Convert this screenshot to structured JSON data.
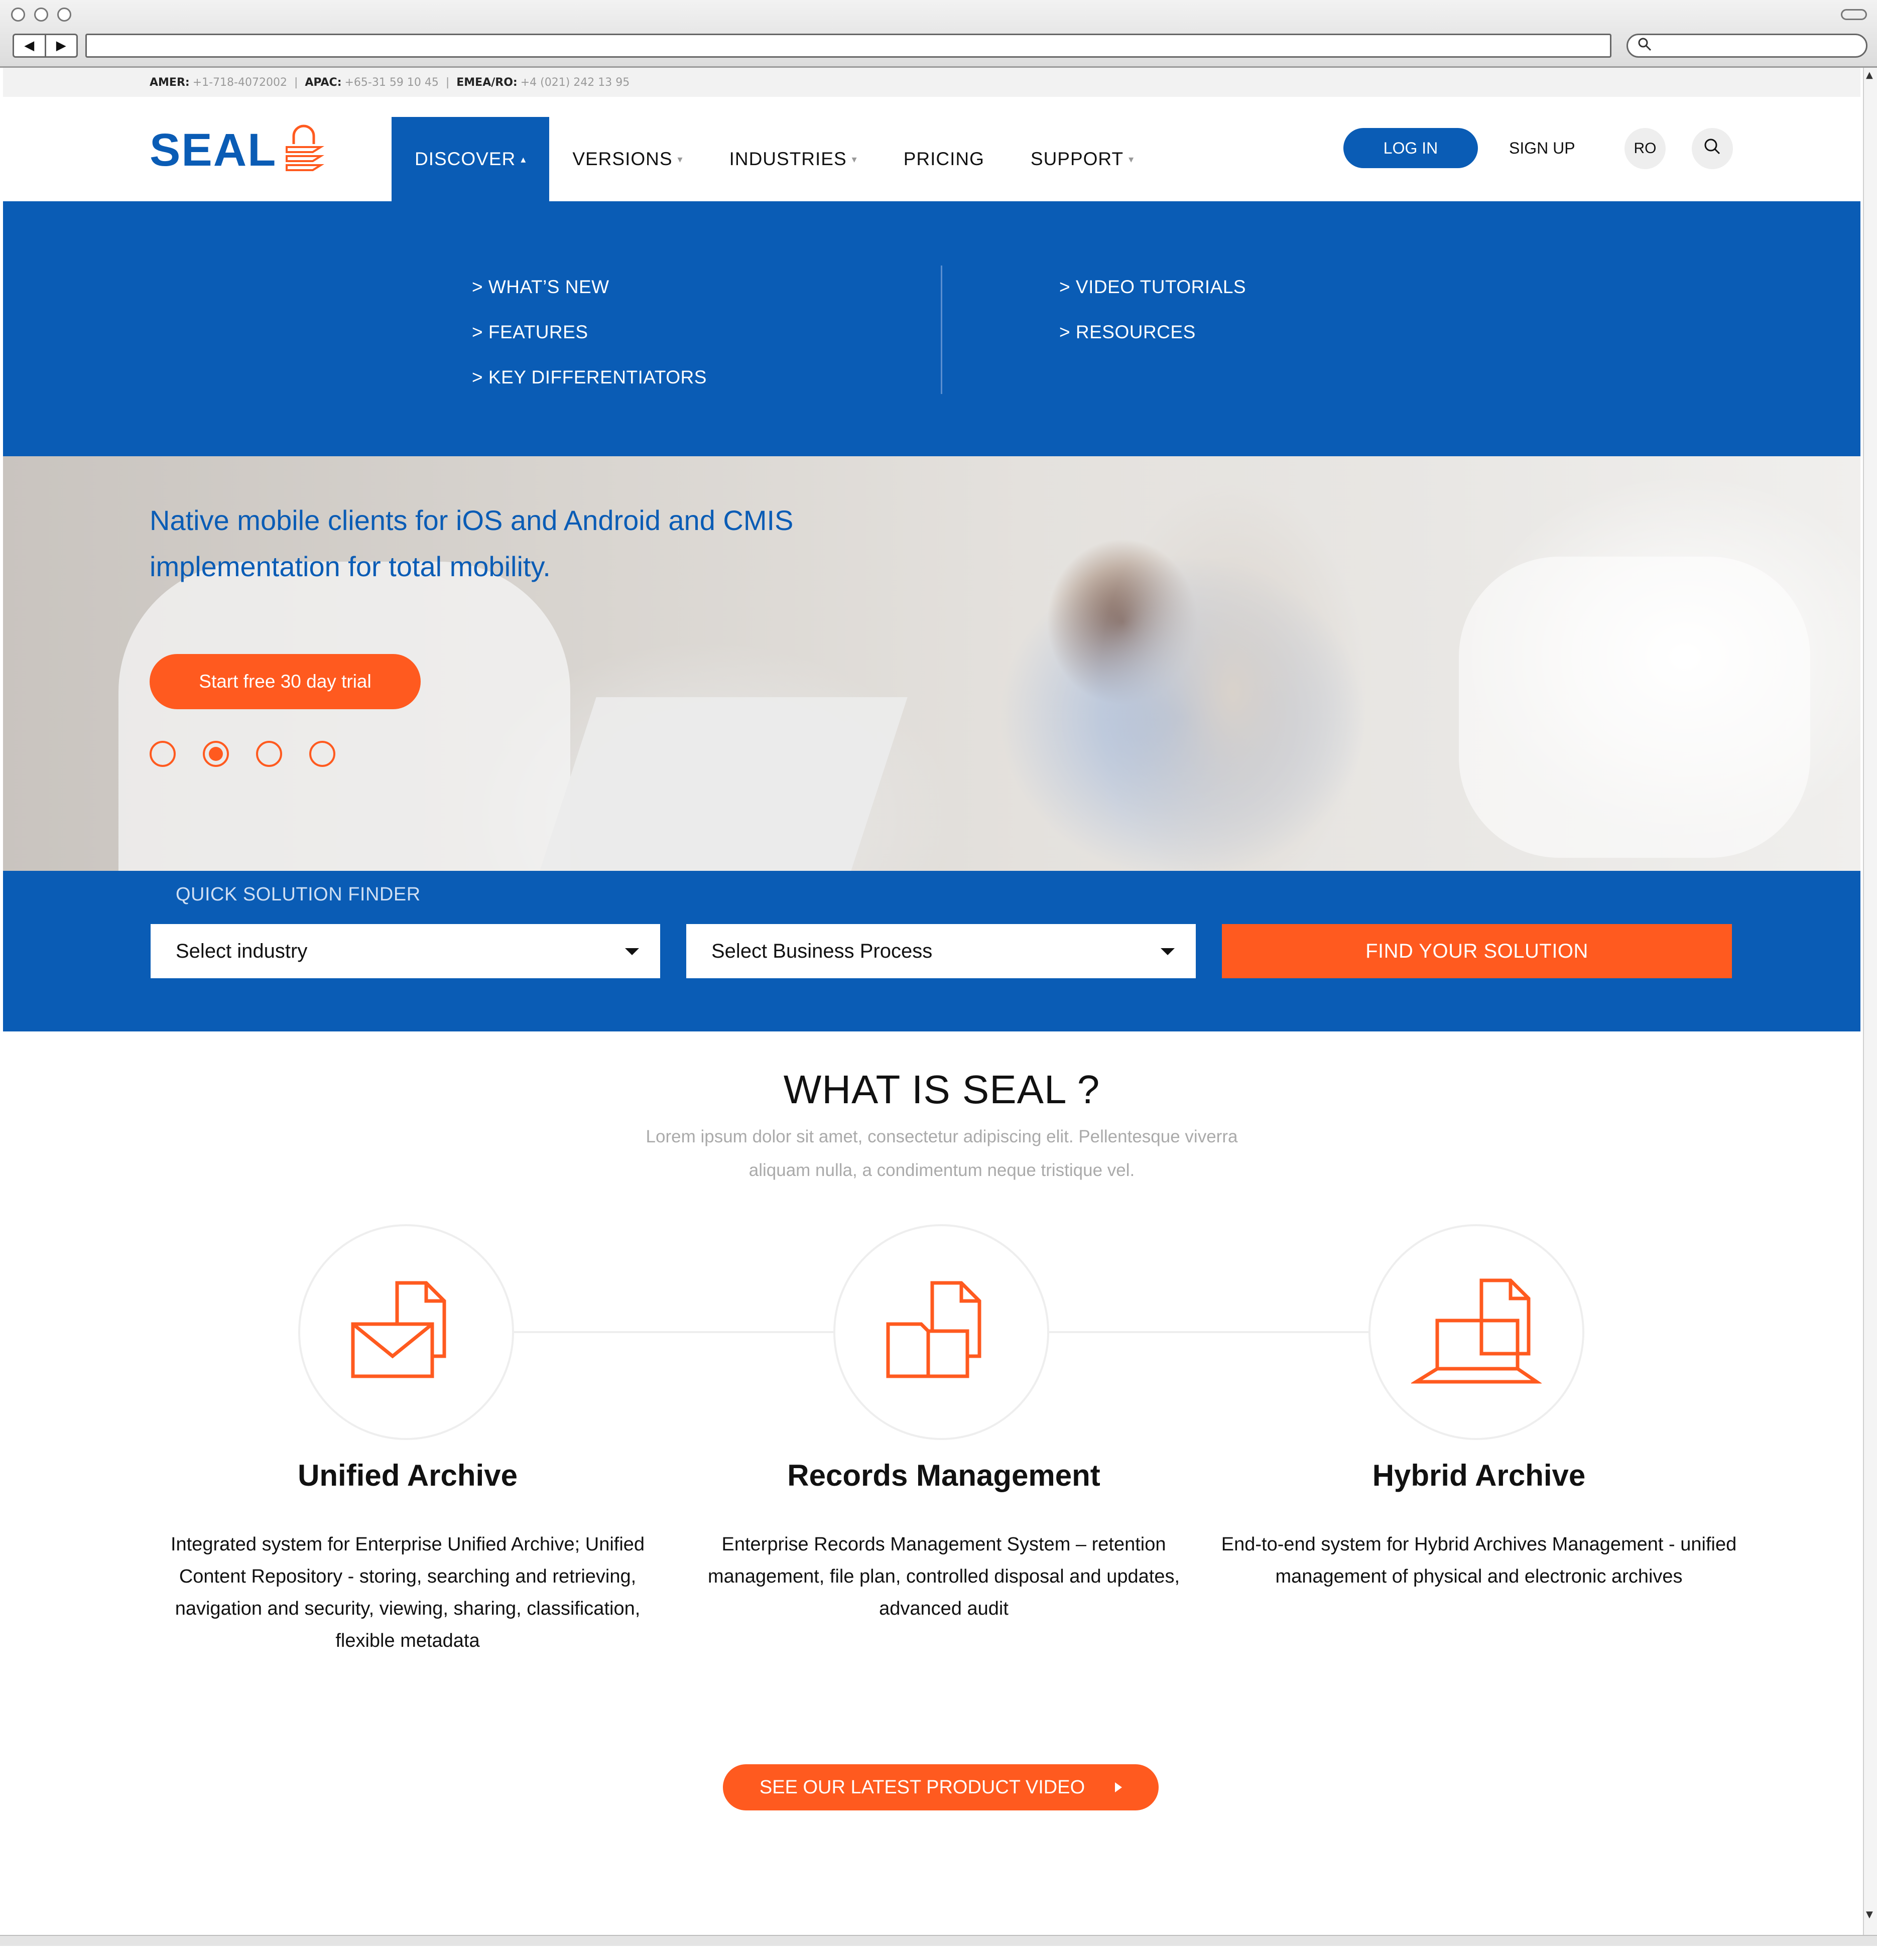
{
  "browser": {
    "back_glyph": "◀",
    "forward_glyph": "▶",
    "url": "",
    "search_icon": "🔍"
  },
  "topbar": {
    "amer_label": "AMER:",
    "amer_phone": "+1-718-4072002",
    "apac_label": "APAC:",
    "apac_phone": "+65-31 59 10 45",
    "emea_label": "EMEA/RO:",
    "emea_phone": "+4 (021) 242 13 95",
    "separator": "|"
  },
  "header": {
    "logo_text": "SEAL",
    "nav": [
      {
        "label": "DISCOVER",
        "caret": "▴",
        "active": true
      },
      {
        "label": "VERSIONS",
        "caret": "▾"
      },
      {
        "label": "INDUSTRIES",
        "caret": "▾"
      },
      {
        "label": "PRICING",
        "caret": ""
      },
      {
        "label": "SUPPORT",
        "caret": "▾"
      }
    ],
    "login_label": "LOG IN",
    "signup_label": "SIGN UP",
    "language_label": "RO"
  },
  "dropdown": {
    "left_links": [
      "> WHAT’S NEW",
      "> FEATURES",
      "> KEY DIFFERENTIATORS"
    ],
    "right_links": [
      "> VIDEO TUTORIALS",
      "> RESOURCES"
    ]
  },
  "hero": {
    "title_line1": "Native mobile clients for iOS and Android and CMIS",
    "title_line2": "implementation for total mobility.",
    "cta_label": "Start free 30 day trial",
    "slides_count": 4,
    "active_slide": 2
  },
  "finder": {
    "label": "QUICK SOLUTION FINDER",
    "industry_value": "Select industry",
    "process_value": "Select Business Process",
    "button_label": "FIND YOUR SOLUTION"
  },
  "about": {
    "title": "WHAT IS SEAL  ?",
    "subtitle_line1": "Lorem ipsum dolor sit amet, consectetur adipiscing elit. Pellentesque viverra",
    "subtitle_line2": "aliquam nulla, a condimentum neque tristique vel.",
    "features": [
      {
        "title": "Unified Archive",
        "icon": "mail-document-icon",
        "text": "Integrated system for Enterprise Unified Archive; Unified Content Repository - storing, searching and retrieving, navigation and security, viewing, sharing, classification, flexible metadata"
      },
      {
        "title": "Records Management",
        "icon": "folder-document-icon",
        "text": "Enterprise Records Management System – retention management, file plan, controlled disposal and updates, advanced audit"
      },
      {
        "title": "Hybrid Archive",
        "icon": "laptop-document-icon",
        "text": "End-to-end system for Hybrid Archives Management - unified management of physical and electronic archives"
      }
    ],
    "video_button_label": "SEE OUR LATEST PRODUCT VIDEO"
  },
  "colors": {
    "brand_blue": "#0a5cb5",
    "accent_orange": "#ff5a1f"
  }
}
